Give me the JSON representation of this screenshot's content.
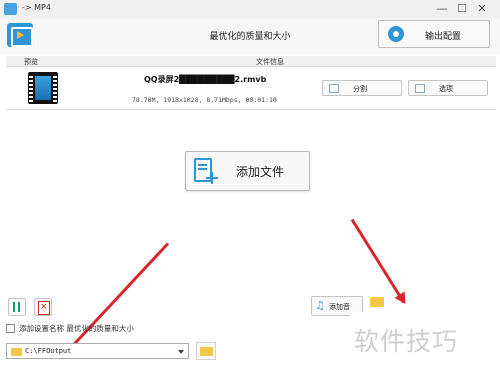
{
  "window": {
    "title": "-> MP4",
    "controls": {
      "minimize": "—",
      "maximize": "☐",
      "close": "✕"
    }
  },
  "header": {
    "profile_title": "最优化的质量和大小",
    "output_config_label": "输出配置",
    "logo_icon": "video-convert-icon",
    "gear_icon": "gear-icon"
  },
  "file_list": {
    "columns": {
      "preview": "预览",
      "info": "文件信息"
    },
    "items": [
      {
        "name": "QQ录屏2█████████2.rmvb",
        "meta": "78.70M, 1918x1028, 8.71Mbps, 00:01:10",
        "split_label": "分割",
        "options_label": "选项"
      }
    ]
  },
  "add_files": {
    "label": "添加文件"
  },
  "toolbar": {
    "sort_icon": "sort-icon",
    "delete_icon": "delete-icon",
    "add_bgm_label": "添加音"
  },
  "settings": {
    "append_name_label": "添加设置名称 最优化的质量和大小"
  },
  "destination": {
    "path": "C:\\FFOutput"
  },
  "watermark": {
    "text": "软件技巧"
  },
  "colors": {
    "accent": "#2e95d6",
    "arrow": "#d9262b",
    "folder": "#f3c74a"
  }
}
